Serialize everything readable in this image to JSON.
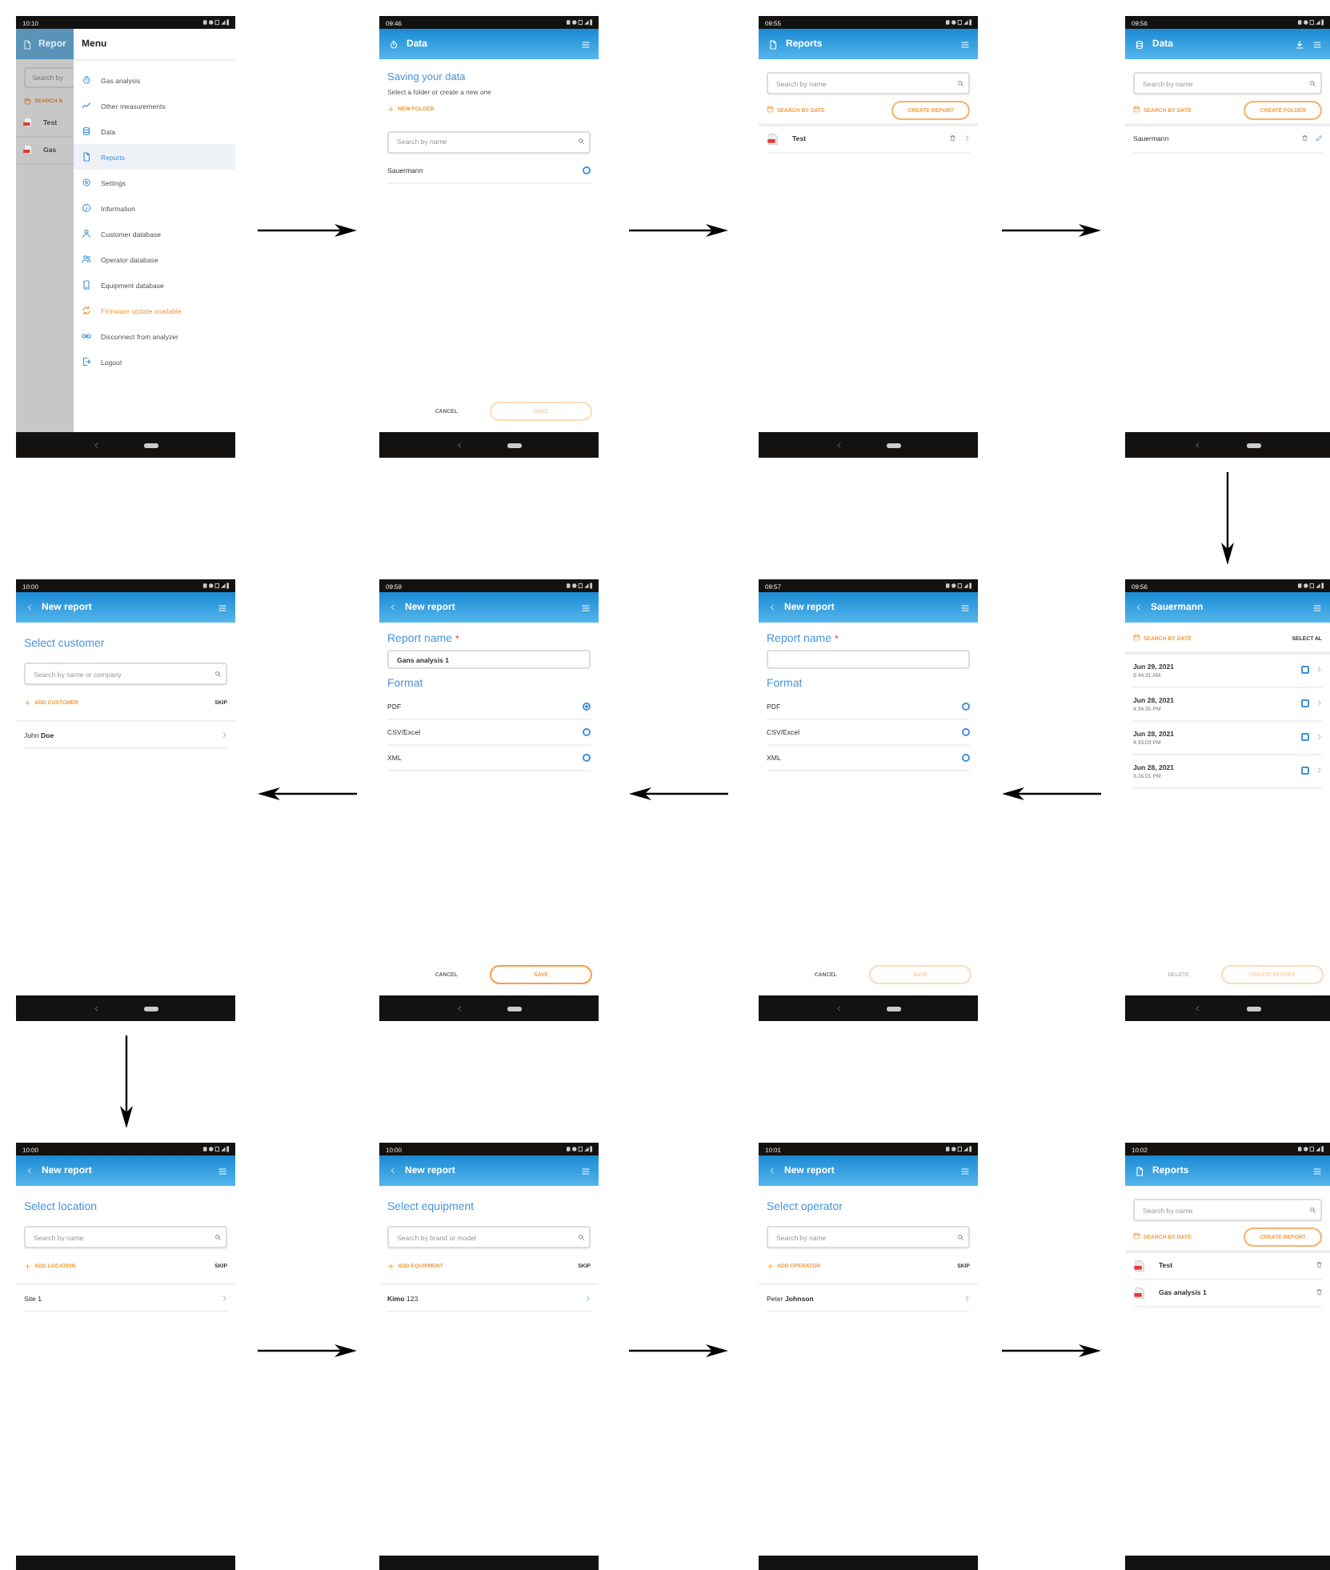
{
  "screens": [
    {
      "kind": "menu",
      "time": "10:10",
      "behind": {
        "title": "Repor",
        "search_placeholder": "Search by",
        "date_button": "SEARCH B",
        "rows": [
          "Test",
          "Gas"
        ]
      },
      "menu": {
        "title": "Menu",
        "items": [
          {
            "label": "Gas analysis",
            "selected": false,
            "kind": "normal"
          },
          {
            "label": "Other measurements",
            "selected": false,
            "kind": "normal"
          },
          {
            "label": "Data",
            "selected": false,
            "kind": "normal"
          },
          {
            "label": "Reports",
            "selected": true,
            "kind": "normal"
          },
          {
            "label": "Settings",
            "selected": false,
            "kind": "normal"
          },
          {
            "label": "Information",
            "selected": false,
            "kind": "normal"
          },
          {
            "label": "Customer database",
            "selected": false,
            "kind": "normal"
          },
          {
            "label": "Operator database",
            "selected": false,
            "kind": "normal"
          },
          {
            "label": "Equipment database",
            "selected": false,
            "kind": "normal"
          },
          {
            "label": "Firmware update available",
            "selected": false,
            "kind": "warning"
          },
          {
            "label": "Disconnect from analyzer",
            "selected": false,
            "kind": "normal"
          },
          {
            "label": "Logout",
            "selected": false,
            "kind": "normal"
          }
        ]
      }
    },
    {
      "kind": "save",
      "time": "09:46",
      "title": "Data",
      "heading": "Saving your data",
      "subtitle": "Select a folder or create a new one",
      "add_label": "NEW FOLDER",
      "search_placeholder": "Search by name",
      "items": [
        {
          "label": "Sauermann",
          "selected": false
        }
      ],
      "cancel": "CANCEL",
      "save": "SAVE",
      "save_disabled": true
    },
    {
      "kind": "browser",
      "time": "09:55",
      "title": "Reports",
      "search_placeholder": "Search by name",
      "date_button": "SEARCH BY DATE",
      "create_button": "CREATE REPORT",
      "rows": [
        {
          "label": "Test",
          "kind": "file",
          "deletable": true,
          "openable": true
        }
      ]
    },
    {
      "kind": "browser",
      "time": "09:56",
      "title": "Data",
      "search_placeholder": "Search by name",
      "date_button": "SEARCH BY DATE",
      "create_button": "CREATE FOLDER",
      "rows": [
        {
          "label": "Sauermann",
          "kind": "folder",
          "deletable": true,
          "editable": true
        }
      ]
    },
    {
      "kind": "select",
      "time": "10:00",
      "title": "New report",
      "heading": "Select customer",
      "search_placeholder": "Search by name or company",
      "add_label": "ADD CUSTOMER",
      "skip": "SKIP",
      "items": [
        "John **Doe**"
      ]
    },
    {
      "kind": "form",
      "time": "09:59",
      "title": "New report",
      "name_label": "Report name",
      "required_mark": "*",
      "name_value": "Gans analysis 1",
      "format_label": "Format",
      "options": [
        {
          "label": "PDF",
          "selected": true
        },
        {
          "label": "CSV/Excel",
          "selected": false
        },
        {
          "label": "XML",
          "selected": false
        }
      ],
      "cancel": "CANCEL",
      "save": "SAVE",
      "save_disabled": false
    },
    {
      "kind": "form",
      "time": "09:57",
      "title": "New report",
      "name_label": "Report name",
      "required_mark": "*",
      "format_label": "Format",
      "options": [
        {
          "label": "PDF",
          "selected": false
        },
        {
          "label": "CSV/Excel",
          "selected": false
        },
        {
          "label": "XML",
          "selected": false
        }
      ],
      "cancel": "CANCEL",
      "save": "SAVE",
      "save_disabled": true
    },
    {
      "kind": "dates",
      "time": "09:56",
      "title": "Sauermann",
      "date_button": "SEARCH BY DATE",
      "select_all": "SELECT AL",
      "rows": [
        {
          "date": "Jun 29, 2021",
          "time": "9:44:31 AM",
          "checked": false
        },
        {
          "date": "Jun 28, 2021",
          "time": "4:34:35 PM",
          "checked": false
        },
        {
          "date": "Jun 28, 2021",
          "time": "4:33:03 PM",
          "checked": false
        },
        {
          "date": "Jun 28, 2021",
          "time": "3:26:01 PM",
          "checked": false
        }
      ],
      "delete": "DELETE",
      "delete_disabled": true,
      "create_button": "CREATE REPORT",
      "create_disabled": true
    },
    {
      "kind": "select",
      "time": "10:00",
      "title": "New report",
      "heading": "Select location",
      "search_placeholder": "Search by name",
      "add_label": "ADD LOCATION",
      "skip": "SKIP",
      "items": [
        "Site 1"
      ]
    },
    {
      "kind": "select",
      "time": "10:00",
      "title": "New report",
      "heading": "Select equipment",
      "search_placeholder": "Search by brand or model",
      "add_label": "ADD EQUIPMENT",
      "skip": "SKIP",
      "items": [
        "**Kimo** 123"
      ]
    },
    {
      "kind": "select",
      "time": "10:01",
      "title": "New report",
      "heading": "Select operator",
      "search_placeholder": "Search by name",
      "add_label": "ADD OPERATOR",
      "skip": "SKIP",
      "items": [
        "Peter **Johnson**"
      ]
    },
    {
      "kind": "browser",
      "time": "10:02",
      "title": "Reports",
      "search_placeholder": "Search by name",
      "date_button": "SEARCH BY DATE",
      "create_button": "CREATE REPORT",
      "rows": [
        {
          "label": "Test",
          "kind": "file",
          "deletable": true
        },
        {
          "label": "Gas analysis 1",
          "kind": "file",
          "deletable": true
        }
      ]
    }
  ]
}
